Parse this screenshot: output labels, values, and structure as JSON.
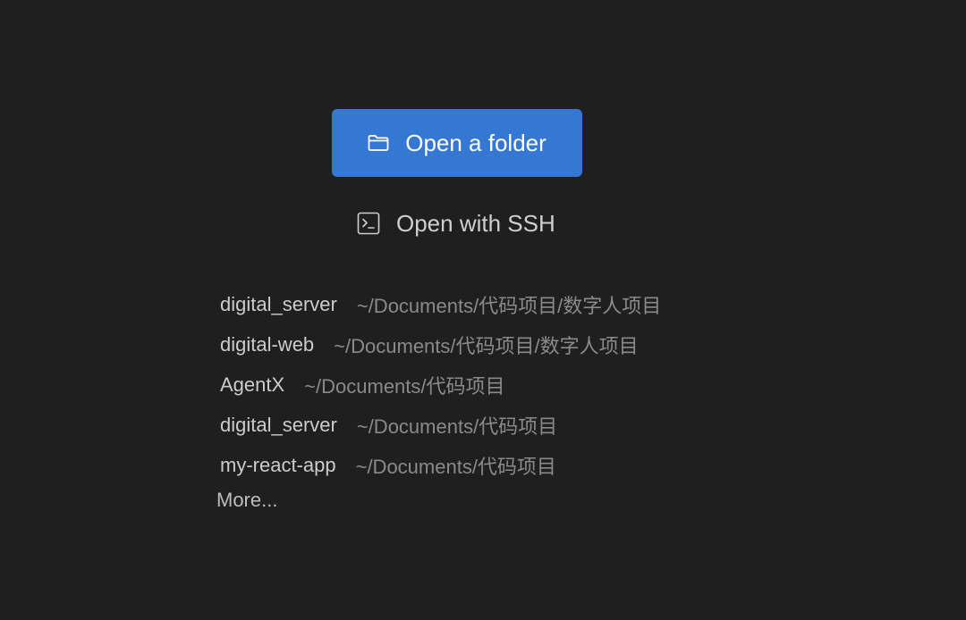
{
  "actions": {
    "open_folder": {
      "label": "Open a folder",
      "icon": "folder-icon"
    },
    "open_ssh": {
      "label": "Open with SSH",
      "icon": "terminal-icon"
    }
  },
  "recent": [
    {
      "name": "digital_server",
      "path": "~/Documents/代码项目/数字人项目"
    },
    {
      "name": "digital-web",
      "path": "~/Documents/代码项目/数字人项目"
    },
    {
      "name": "AgentX",
      "path": "~/Documents/代码项目"
    },
    {
      "name": "digital_server",
      "path": "~/Documents/代码项目"
    },
    {
      "name": "my-react-app",
      "path": "~/Documents/代码项目"
    }
  ],
  "more_label": "More...",
  "colors": {
    "background": "#1f1f1f",
    "accent": "#3478d4"
  }
}
